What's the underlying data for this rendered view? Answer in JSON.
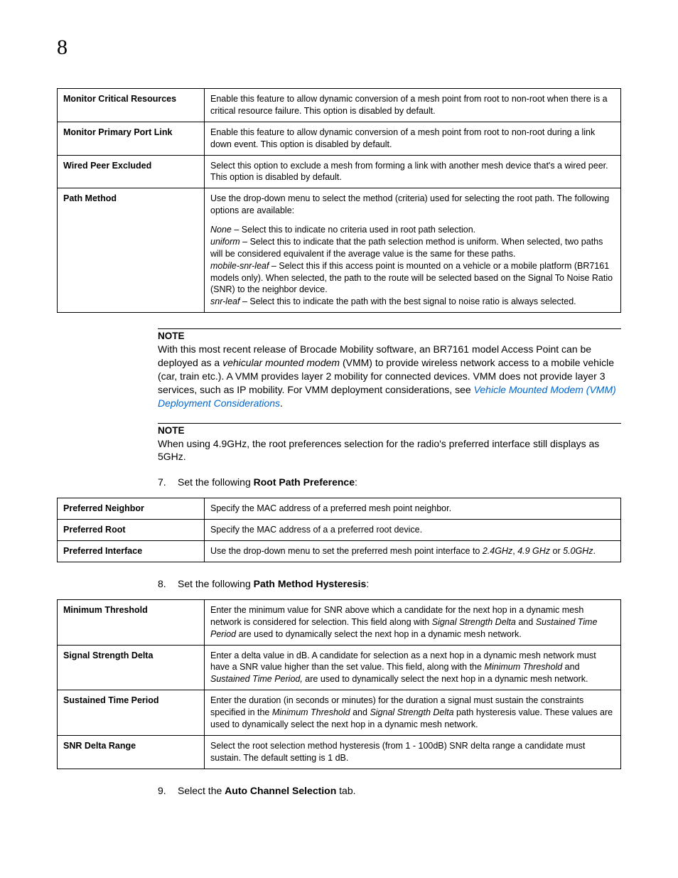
{
  "chapter": "8",
  "table1": {
    "rows": [
      {
        "label": "Monitor Critical Resources",
        "desc": "Enable this feature to allow dynamic conversion of a mesh point from root to non-root when there is a critical resource failure. This option is disabled by default."
      },
      {
        "label": "Monitor Primary Port Link",
        "desc": "Enable this feature to allow dynamic conversion of a mesh point from root to non-root during a link down event. This option is disabled by default."
      },
      {
        "label": "Wired Peer Excluded",
        "desc": "Select this option to exclude a mesh from forming a link with another mesh device that's a wired peer. This option is disabled by default."
      },
      {
        "label": "Path Method",
        "desc_intro": "Use the drop-down menu to select the method (criteria) used for selecting the root path. The following options are available:",
        "opts": [
          {
            "name": "None",
            "text": " – Select this to indicate no criteria used in root path selection."
          },
          {
            "name": "uniform",
            "text": " – Select this to indicate that the path selection method is uniform. When selected, two paths will be considered equivalent if the average value is the same for these paths."
          },
          {
            "name": "mobile-snr-leaf",
            "text": " – Select this if this access point is mounted on a vehicle or a mobile platform (BR7161 models only). When selected, the path to the route will be selected based on the Signal To Noise Ratio (SNR) to the neighbor device."
          },
          {
            "name": "snr-leaf",
            "text": " – Select this to indicate the path with the best signal to noise ratio is always selected."
          }
        ]
      }
    ]
  },
  "note1": {
    "title": "NOTE",
    "part1": "With this most recent release of Brocade Mobility software, an BR7161 model Access Point can be deployed as a ",
    "italic1": "vehicular mounted modem",
    "part2": " (VMM) to provide wireless network access to a mobile vehicle (car, train etc.). A VMM provides layer 2 mobility for connected devices. VMM does not provide layer 3 services, such as IP mobility. For VMM deployment considerations, see ",
    "link": "Vehicle Mounted Modem (VMM) Deployment Considerations",
    "part3": "."
  },
  "note2": {
    "title": "NOTE",
    "body": "When using 4.9GHz, the root preferences selection for the radio's preferred interface still displays as 5GHz."
  },
  "step7": {
    "num": "7.",
    "pre": "Set the following ",
    "bold": "Root Path Preference",
    "post": ":"
  },
  "table2": {
    "rows": [
      {
        "label": "Preferred Neighbor",
        "desc": "Specify the MAC address of a preferred mesh point neighbor."
      },
      {
        "label": "Preferred Root",
        "desc": "Specify the MAC address of a a preferred root device."
      },
      {
        "label": "Preferred Interface",
        "pre": "Use the drop-down menu to set the preferred mesh point interface to ",
        "i1": "2.4GHz",
        "m1": ", ",
        "i2": "4.9 GHz",
        "m2": " or ",
        "i3": "5.0GHz",
        "post": "."
      }
    ]
  },
  "step8": {
    "num": "8.",
    "pre": "Set the following ",
    "bold": "Path Method Hysteresis",
    "post": ":"
  },
  "table3": {
    "rows": [
      {
        "label": "Minimum Threshold",
        "pre": "Enter the minimum value for SNR above which a candidate for the next hop in a dynamic mesh network is considered for selection. This field along with ",
        "i1": "Signal Strength Delta",
        "m1": " and ",
        "i2": "Sustained Time Period",
        "post": " are used to dynamically select the next hop in a dynamic mesh network."
      },
      {
        "label": "Signal Strength Delta",
        "pre": "Enter a delta value in dB. A candidate for selection as a next hop in a dynamic mesh network must have a SNR value higher than the set value. This field, along with the ",
        "i1": "Minimum Threshold",
        "m1": " and ",
        "i2": "Sustained Time Period,",
        "post": " are used to dynamically select the next hop in a dynamic mesh network."
      },
      {
        "label": "Sustained Time Period",
        "pre": "Enter the duration (in seconds or minutes) for the duration a signal must sustain the constraints specified in the ",
        "i1": "Minimum Threshold",
        "m1": " and ",
        "i2": "Signal Strength Delta",
        "post": " path hysteresis value. These values are used to dynamically select the next hop in a dynamic mesh network."
      },
      {
        "label": "SNR Delta Range",
        "desc": "Select the root selection method hysteresis (from 1 - 100dB) SNR delta range a candidate must sustain. The default setting is 1 dB."
      }
    ]
  },
  "step9": {
    "num": "9.",
    "pre": "Select the ",
    "bold": "Auto Channel Selection",
    "post": " tab."
  }
}
